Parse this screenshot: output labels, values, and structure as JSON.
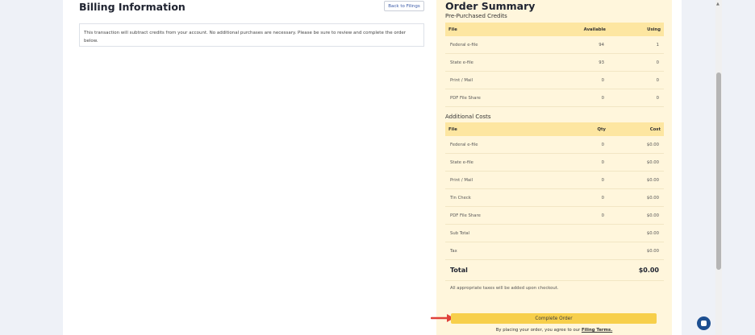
{
  "billing": {
    "title": "Billing Information",
    "back_label": "Back to Filings",
    "notice": "This transaction will subtract credits from your account. No additional purchases are necessary. Please be sure to review and complete the order below."
  },
  "summary": {
    "title": "Order Summary",
    "prepurchased": {
      "title": "Pre-Purchased Credits",
      "headers": [
        "File",
        "Available",
        "Using"
      ],
      "rows": [
        [
          "Federal e-file",
          "94",
          "1"
        ],
        [
          "State e-file",
          "93",
          "0"
        ],
        [
          "Print / Mail",
          "0",
          "0"
        ],
        [
          "PDF File Share",
          "0",
          "0"
        ]
      ]
    },
    "additional": {
      "title": "Additional Costs",
      "headers": [
        "File",
        "Qty",
        "Cost"
      ],
      "rows": [
        [
          "Federal e-file",
          "0",
          "$0.00"
        ],
        [
          "State e-file",
          "0",
          "$0.00"
        ],
        [
          "Print / Mail",
          "0",
          "$0.00"
        ],
        [
          "Tin Check",
          "0",
          "$0.00"
        ],
        [
          "PDF File Share",
          "0",
          "$0.00"
        ]
      ],
      "subtotal_label": "Sub Total",
      "subtotal_value": "$0.00",
      "tax_label": "Tax",
      "tax_value": "$0.00",
      "total_label": "Total",
      "total_value": "$0.00"
    },
    "taxes_note": "All appropriate taxes will be added upon checkout.",
    "complete_label": "Complete Order",
    "terms_prefix": "By placing your order, you agree to our",
    "terms_link": "Filing Terms."
  },
  "colors": {
    "accent": "#f7cf4b",
    "summary_bg": "#fff6dc",
    "header_bg": "#fde6a1",
    "arrow": "#e0413a",
    "chat": "#1d4f91"
  },
  "icons": {
    "arrow": "right-arrow-icon",
    "chat": "chat-icon"
  }
}
